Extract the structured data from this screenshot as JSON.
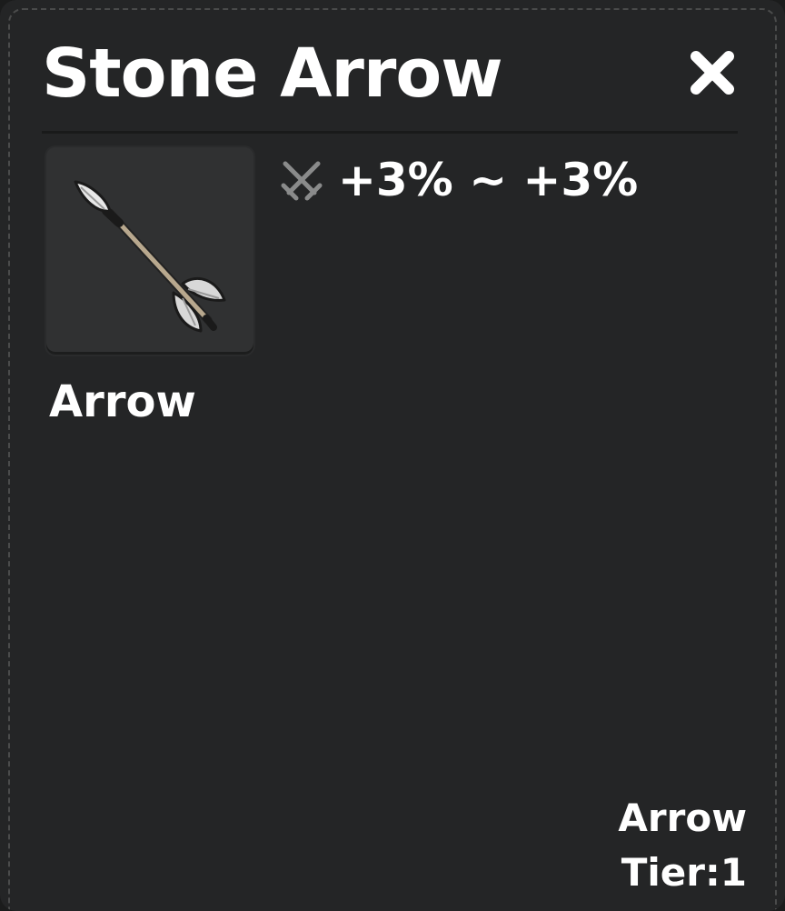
{
  "panel": {
    "title": "Stone Arrow",
    "close_icon": "close-icon"
  },
  "item": {
    "icon": "stone-arrow-icon",
    "type_label": "Arrow"
  },
  "stats": [
    {
      "icon": "crossed-swords-icon",
      "value": "+3% ~ +3%"
    }
  ],
  "footer": {
    "category": "Arrow",
    "tier": "Tier:1"
  },
  "colors": {
    "panel_bg": "#242526",
    "slot_bg": "#303132",
    "text": "#ffffff",
    "icon_muted": "#8a8b8b"
  }
}
